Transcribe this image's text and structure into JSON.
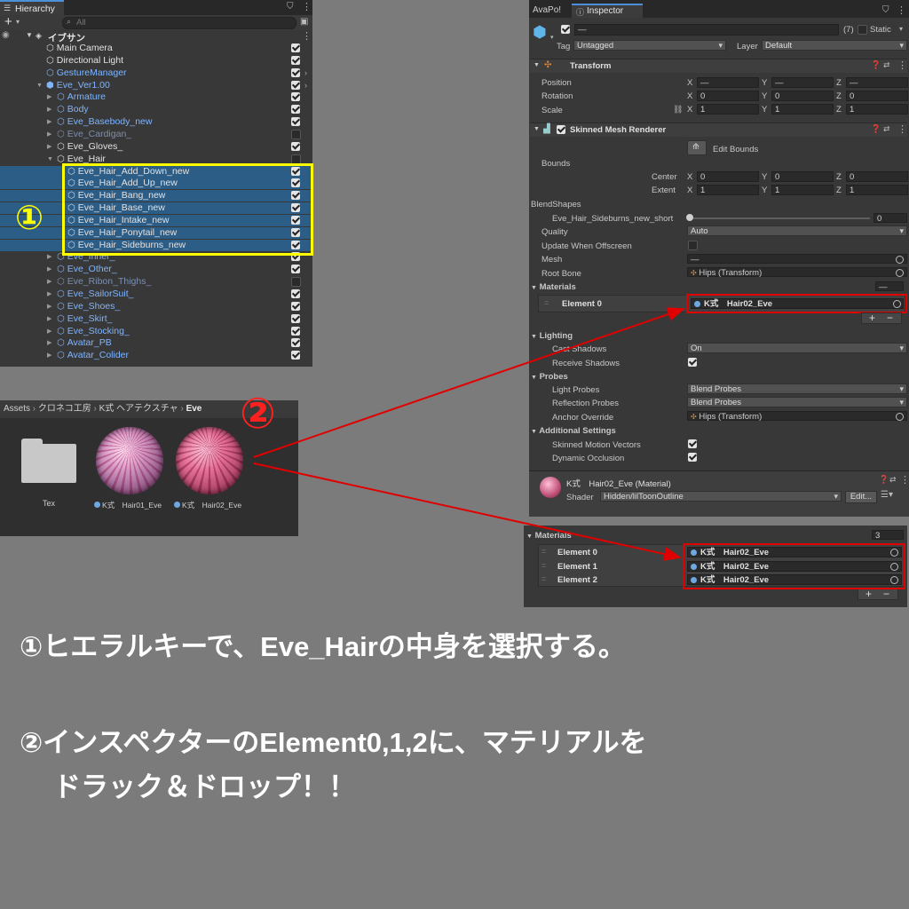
{
  "hierarchy": {
    "tab": "Hierarchy",
    "search_placeholder": "All",
    "add": "+",
    "scene": "イブサン",
    "rows": [
      {
        "label": "Main Camera",
        "color": "normal",
        "checked": true,
        "indent": 0
      },
      {
        "label": "Directional Light",
        "color": "normal",
        "checked": true,
        "indent": 0
      },
      {
        "label": "GestureManager",
        "color": "blue",
        "checked": true,
        "indent": 0
      },
      {
        "label": "Eve_Ver1.00",
        "color": "blue",
        "checked": true,
        "indent": 0
      },
      {
        "label": "Armature",
        "color": "blue",
        "checked": true,
        "indent": 1
      },
      {
        "label": "Body",
        "color": "blue",
        "checked": true,
        "indent": 1
      },
      {
        "label": "Eve_Basebody_new",
        "color": "blue",
        "checked": true,
        "indent": 1
      },
      {
        "label": "Eve_Cardigan_",
        "color": "dim",
        "checked": false,
        "indent": 1
      },
      {
        "label": "Eve_Gloves_",
        "color": "normal",
        "checked": true,
        "indent": 1
      },
      {
        "label": "Eve_Hair",
        "color": "normal",
        "checked": false,
        "indent": 1
      },
      {
        "label": "Eve_Hair_Add_Down_new",
        "color": "normal",
        "checked": true,
        "indent": 2,
        "selected": true
      },
      {
        "label": "Eve_Hair_Add_Up_new",
        "color": "normal",
        "checked": true,
        "indent": 2,
        "selected": true
      },
      {
        "label": "Eve_Hair_Bang_new",
        "color": "normal",
        "checked": true,
        "indent": 2,
        "selected": true
      },
      {
        "label": "Eve_Hair_Base_new",
        "color": "normal",
        "checked": true,
        "indent": 2,
        "selected": true
      },
      {
        "label": "Eve_Hair_Intake_new",
        "color": "normal",
        "checked": true,
        "indent": 2,
        "selected": true
      },
      {
        "label": "Eve_Hair_Ponytail_new",
        "color": "normal",
        "checked": true,
        "indent": 2,
        "selected": true
      },
      {
        "label": "Eve_Hair_Sideburns_new",
        "color": "normal",
        "checked": true,
        "indent": 2,
        "selected": true
      },
      {
        "label": "Eve_Inner_",
        "color": "blue",
        "checked": true,
        "indent": 1
      },
      {
        "label": "Eve_Other_",
        "color": "blue",
        "checked": true,
        "indent": 1
      },
      {
        "label": "Eve_Ribon_Thighs_",
        "color": "dim",
        "checked": false,
        "indent": 1
      },
      {
        "label": "Eve_SailorSuit_",
        "color": "blue",
        "checked": true,
        "indent": 1
      },
      {
        "label": "Eve_Shoes_",
        "color": "blue",
        "checked": true,
        "indent": 1
      },
      {
        "label": "Eve_Skirt_",
        "color": "blue",
        "checked": true,
        "indent": 1
      },
      {
        "label": "Eve_Stocking_",
        "color": "blue",
        "checked": true,
        "indent": 1
      },
      {
        "label": "Avatar_PB",
        "color": "blue",
        "checked": true,
        "indent": 1
      },
      {
        "label": "Avatar_Colider",
        "color": "blue",
        "checked": true,
        "indent": 1
      }
    ]
  },
  "project": {
    "breadcrumb": [
      "Assets",
      "クロネコ工房",
      "K式 ヘアテクスチャ",
      "Eve"
    ],
    "items": [
      {
        "name": "Tex",
        "kind": "folder"
      },
      {
        "name": "K式　Hair01_Eve",
        "kind": "material"
      },
      {
        "name": "K式　Hair02_Eve",
        "kind": "material"
      }
    ]
  },
  "inspector": {
    "tabs": [
      "AvaPo!",
      "Inspector"
    ],
    "name_value": "—",
    "count": "(7)",
    "static": "Static",
    "tag_label": "Tag",
    "tag_value": "Untagged",
    "layer_label": "Layer",
    "layer_value": "Default",
    "transform": {
      "title": "Transform",
      "position": "Position",
      "rotation": "Rotation",
      "scale": "Scale",
      "pos": [
        "—",
        "—",
        "—"
      ],
      "rot": [
        "0",
        "0",
        "0"
      ],
      "scl": [
        "1",
        "1",
        "1"
      ]
    },
    "smr": {
      "title": "Skinned Mesh Renderer",
      "edit_bounds": "Edit Bounds",
      "bounds": "Bounds",
      "center": "Center",
      "extent": "Extent",
      "center_v": [
        "0",
        "0",
        "0"
      ],
      "extent_v": [
        "1",
        "1",
        "1"
      ],
      "blendshapes": "BlendShapes",
      "blend_name": "Eve_Hair_Sideburns_new_short",
      "blend_value": "0",
      "quality": "Quality",
      "quality_v": "Auto",
      "update_offscreen": "Update When Offscreen",
      "mesh": "Mesh",
      "mesh_v": "—",
      "root_bone": "Root Bone",
      "root_bone_v": "Hips (Transform)",
      "materials": "Materials",
      "materials_count": "—",
      "element0": "Element 0",
      "element0_v": "K式　Hair02_Eve",
      "lighting": "Lighting",
      "cast_shadows": "Cast Shadows",
      "cast_shadows_v": "On",
      "receive_shadows": "Receive Shadows",
      "probes": "Probes",
      "light_probes": "Light Probes",
      "light_probes_v": "Blend Probes",
      "reflection_probes": "Reflection Probes",
      "reflection_probes_v": "Blend Probes",
      "anchor_override": "Anchor Override",
      "anchor_override_v": "Hips (Transform)",
      "additional": "Additional Settings",
      "skinned_motion": "Skinned Motion Vectors",
      "dynamic_occlusion": "Dynamic Occlusion"
    },
    "material": {
      "title": "K式　Hair02_Eve (Material)",
      "shader_label": "Shader",
      "shader_value": "Hidden/lilToonOutline",
      "edit": "Edit..."
    }
  },
  "materials2": {
    "title": "Materials",
    "count": "3",
    "elements": [
      {
        "label": "Element 0",
        "value": "K式　Hair02_Eve"
      },
      {
        "label": "Element 1",
        "value": "K式　Hair02_Eve"
      },
      {
        "label": "Element 2",
        "value": "K式　Hair02_Eve"
      }
    ]
  },
  "annotations": {
    "step1": "①",
    "step2": "②",
    "caption1": "①ヒエラルキーで、Eve_Hairの中身を選択する。",
    "caption2a": "②インスペクターのElement0,1,2に、マテリアルを",
    "caption2b": "ドラック＆ドロップ！！"
  },
  "colors": {
    "highlight": "#ffff00",
    "redbox": "#e00000",
    "selection": "#2c5d87",
    "link": "#7fb5ff"
  }
}
